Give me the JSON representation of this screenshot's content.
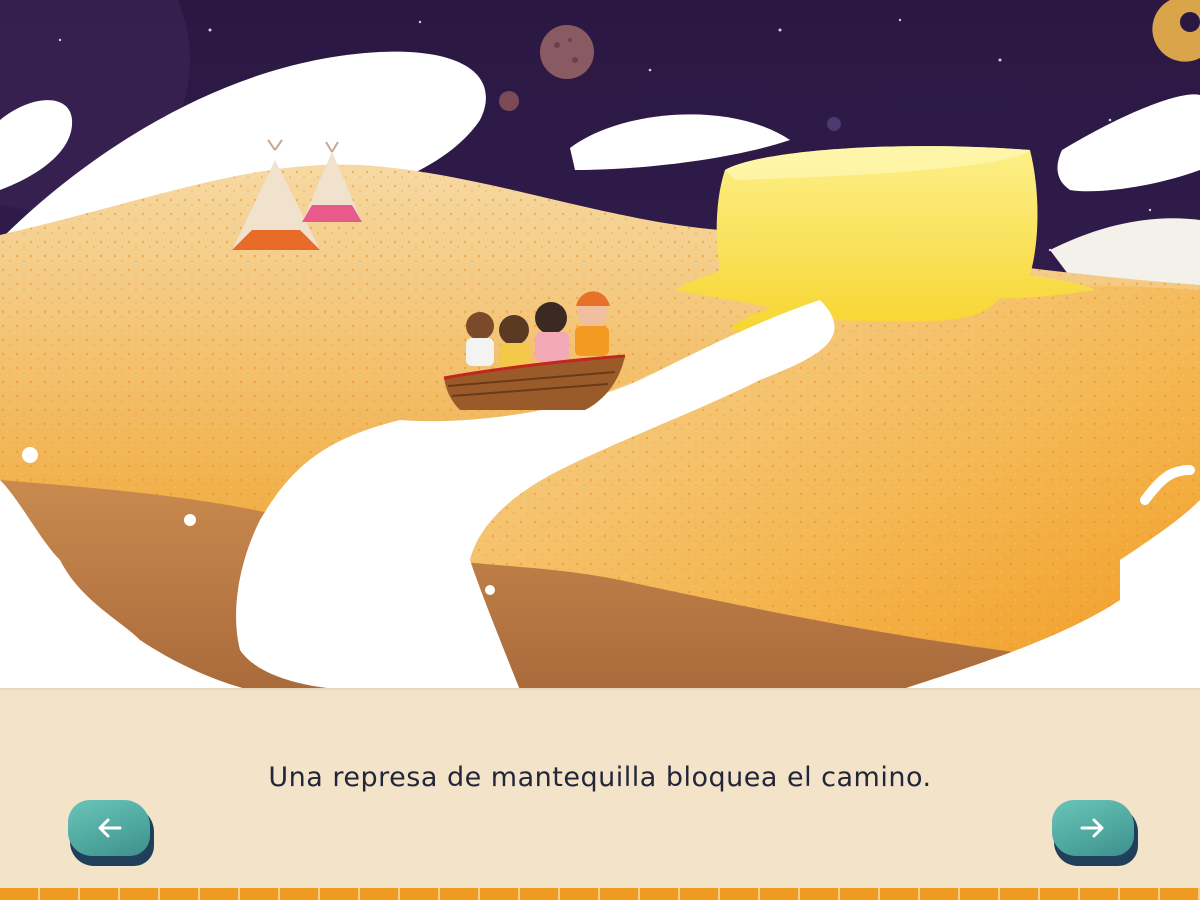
{
  "story": {
    "caption": "Una represa de mantequilla bloquea el camino."
  },
  "navigation": {
    "prev_icon": "arrow-left-icon",
    "next_icon": "arrow-right-icon"
  },
  "colors": {
    "sky": "#2e1b4a",
    "sand": "#f2b54a",
    "milk": "#ffffff",
    "butter": "#fbe052",
    "caption_panel": "#f3e4c9",
    "caption_text": "#23263a",
    "button": "#4ea79f",
    "button_shadow": "#1f3f5a",
    "bottom_strip": "#f19a21"
  }
}
